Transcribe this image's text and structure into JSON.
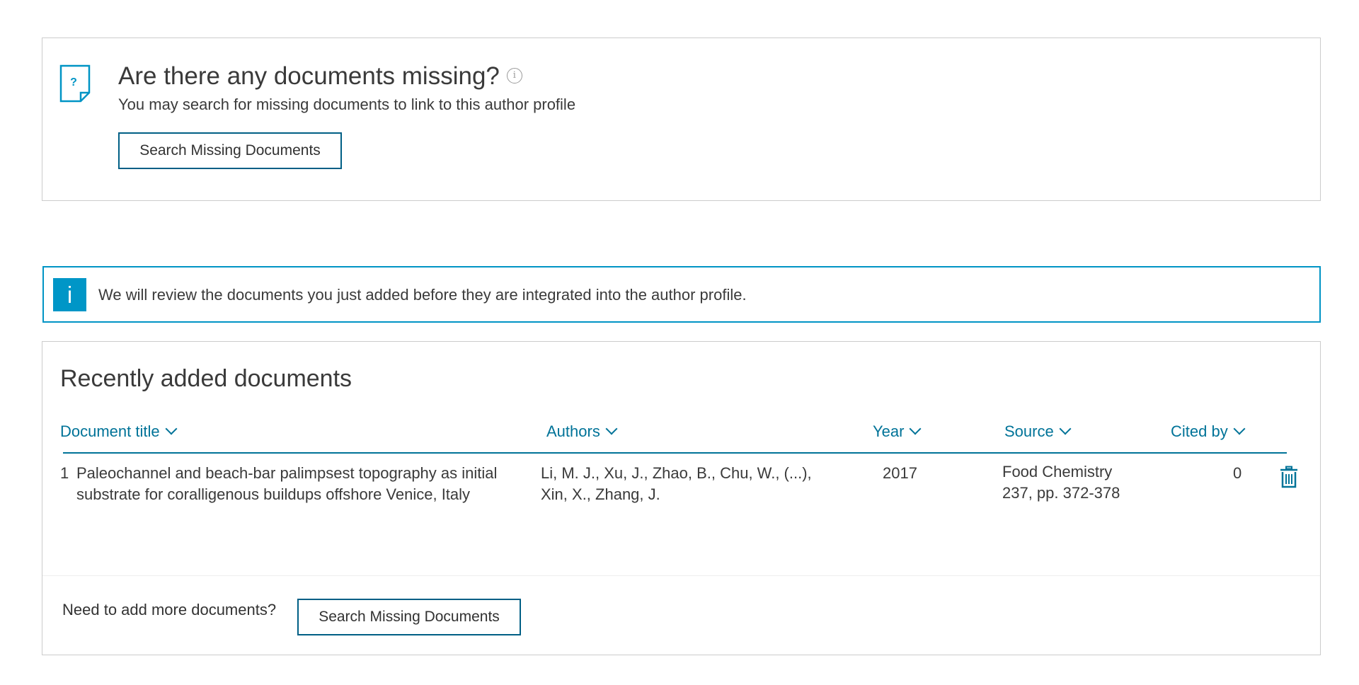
{
  "missing_panel": {
    "title": "Are there any documents missing?",
    "info_icon": "i",
    "subtitle": "You may search for missing documents to link to this author profile",
    "button_label": "Search Missing Documents"
  },
  "alert": {
    "icon": "i",
    "text": "We will review the documents you just added before they are integrated into the author profile."
  },
  "recent": {
    "title": "Recently added documents",
    "columns": {
      "title": "Document title",
      "authors": "Authors",
      "year": "Year",
      "source": "Source",
      "cited_by": "Cited by"
    },
    "rows": [
      {
        "num": "1",
        "title": "Paleochannel and beach-bar palimpsest topography as initial substrate for coralligenous buildups offshore Venice, Italy",
        "authors": "Li, M. J., Xu, J., Zhao, B., Chu, W., (...), Xin, X., Zhang, J.",
        "year": "2017",
        "source_name": "Food Chemistry",
        "source_detail": "237, pp. 372-378",
        "cited_by": "0"
      }
    ],
    "footer_text": "Need to add more documents?",
    "footer_button_label": "Search Missing Documents"
  },
  "colors": {
    "accent": "#007398",
    "alert_border": "#0094c5",
    "alert_icon_bg": "#0096c7",
    "button_border": "#005f85",
    "panel_border": "#cccccc"
  }
}
